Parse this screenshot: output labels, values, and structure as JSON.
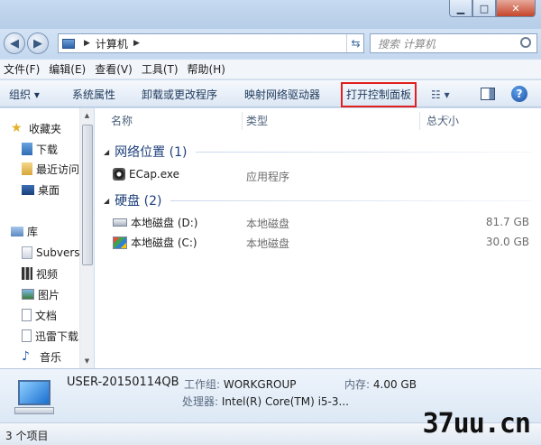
{
  "address": {
    "segments": [
      "计算机"
    ]
  },
  "search": {
    "placeholder": "搜索 计算机"
  },
  "menu": [
    "文件(F)",
    "编辑(E)",
    "查看(V)",
    "工具(T)",
    "帮助(H)"
  ],
  "toolbar": {
    "organize": "组织 ▾",
    "system_properties": "系统属性",
    "uninstall": "卸载或更改程序",
    "map_drive": "映射网络驱动器",
    "control_panel": "打开控制面板"
  },
  "sidebar": {
    "favorites_title": "收藏夹",
    "favorites": [
      "下载",
      "最近访问",
      "桌面"
    ],
    "libraries_title": "库",
    "libraries": [
      "Subversion",
      "视频",
      "图片",
      "文档",
      "迅雷下载",
      "音乐"
    ]
  },
  "columns": {
    "name": "名称",
    "type": "类型",
    "size": "总大小"
  },
  "groups": {
    "network": {
      "label": "网络位置 (1)"
    },
    "disks": {
      "label": "硬盘 (2)"
    }
  },
  "items": {
    "network": [
      {
        "name": "ECap.exe",
        "type": "应用程序",
        "size": ""
      }
    ],
    "disks": [
      {
        "name": "本地磁盘 (D:)",
        "type": "本地磁盘",
        "size": "81.7 GB"
      },
      {
        "name": "本地磁盘 (C:)",
        "type": "本地磁盘",
        "size": "30.0 GB"
      }
    ]
  },
  "details": {
    "computer_name": "USER-20150114QB",
    "workgroup_label": "工作组:",
    "workgroup": "WORKGROUP",
    "memory_label": "内存:",
    "memory": "4.00 GB",
    "processor_label": "处理器:",
    "processor": "Intel(R) Core(TM) i5-3..."
  },
  "status": {
    "count": "3 个项目"
  },
  "watermark": "37uu.cn",
  "colors": {
    "highlight_border": "#e02020",
    "group_text": "#1d3f7a"
  }
}
